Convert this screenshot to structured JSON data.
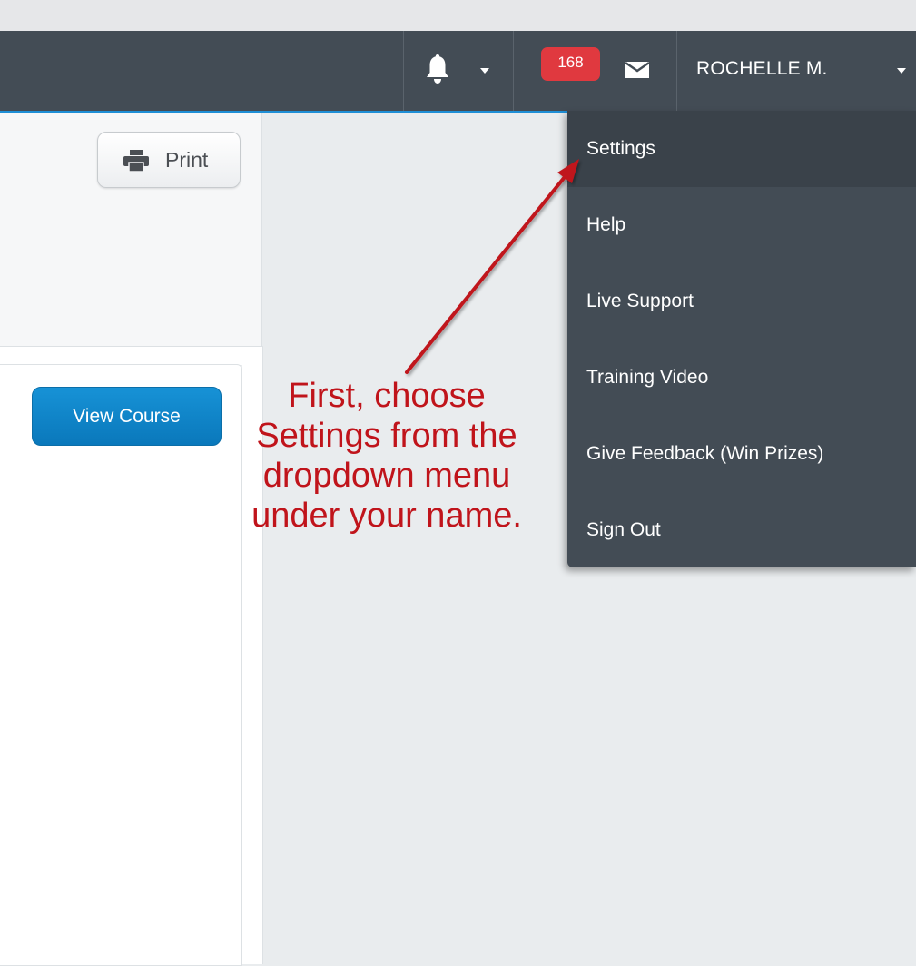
{
  "navbar": {
    "notifications_icon": "bell-icon",
    "messages_count": "168",
    "messages_icon": "envelope-icon",
    "user_name": "ROCHELLE M."
  },
  "toolbar": {
    "print_label": "Print",
    "print_icon": "printer-icon"
  },
  "course": {
    "view_course_label": "View Course"
  },
  "user_menu": {
    "items": [
      {
        "label": "Settings"
      },
      {
        "label": "Help"
      },
      {
        "label": "Live Support"
      },
      {
        "label": "Training Video"
      },
      {
        "label": "Give Feedback (Win Prizes)"
      },
      {
        "label": "Sign Out"
      }
    ]
  },
  "annotation": {
    "lines": [
      "First, choose",
      "Settings from the",
      "dropdown menu",
      "under your name."
    ],
    "color": "#c0141b"
  },
  "colors": {
    "navbar": "#434c55",
    "accent": "#1f8fd6",
    "badge": "#e0393f",
    "primary_button": "#0a78bb"
  }
}
